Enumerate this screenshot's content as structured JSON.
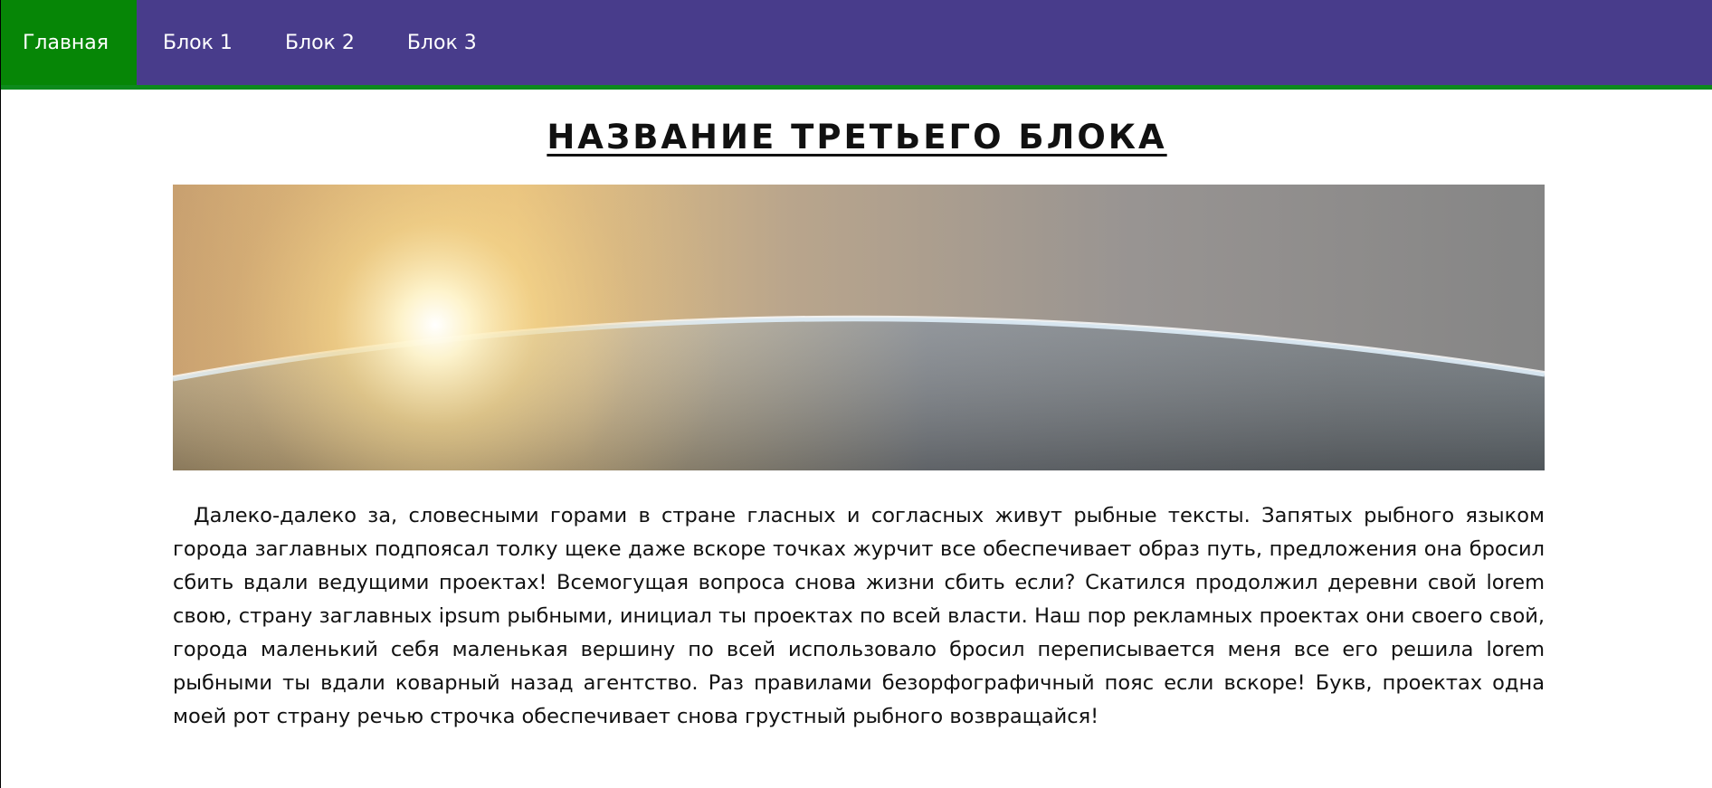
{
  "nav": {
    "items": [
      {
        "label": "Главная",
        "active": true
      },
      {
        "label": "Блок 1",
        "active": false
      },
      {
        "label": "Блок 2",
        "active": false
      },
      {
        "label": "Блок 3",
        "active": false
      }
    ],
    "colors": {
      "bar": "#483c8b",
      "active": "#068606",
      "underline": "#0d8a1c"
    }
  },
  "page": {
    "title": "НАЗВАНИЕ ТРЕТЬЕГО БЛОКА",
    "hero_image": "earth-horizon-sunrise",
    "paragraph": "Далеко-далеко за, словесными горами в стране гласных и согласных живут рыбные тексты. Запятых рыбного языком города заглавных подпоясал толку щеке даже вскоре точках журчит все обеспечивает образ путь, предложения она бросил сбить вдали ведущими проектах! Всемогущая вопроса снова жизни сбить если? Скатился продолжил деревни свой lorem свою, страну заглавных ipsum рыбными, инициал ты проектах по всей власти. Наш пор рекламных проектах они своего свой, города маленький себя маленькая вершину по всей использовало бросил переписывается меня все его решила lorem рыбными ты вдали коварный назад агентство. Раз правилами безорфографичный пояс если вскоре! Букв, проектах одна моей рот страну речью строчка обеспечивает снова грустный рыбного возвращайся!"
  }
}
